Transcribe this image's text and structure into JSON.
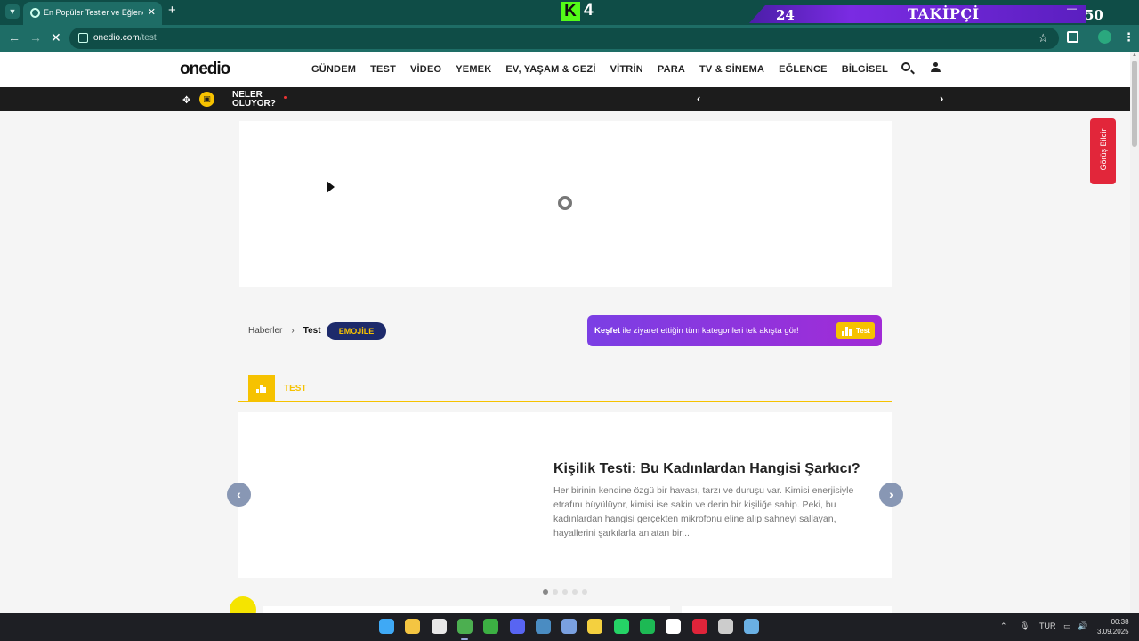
{
  "browser": {
    "tab_title": "En Popüler Testler ve Eğlenceli Testler",
    "url_domain": "onedio.com",
    "url_path": "/test",
    "overlay": {
      "stream_letter": "K",
      "stream_number": "4",
      "follower_count": "24",
      "follower_label": "TAKİPÇİ",
      "follower_target": "50"
    }
  },
  "site": {
    "logo": "onedio",
    "nav": [
      "GÜNDEM",
      "TEST",
      "VİDEO",
      "YEMEK",
      "EV, YAŞAM & GEZİ",
      "VİTRİN",
      "PARA",
      "TV & SİNEMA",
      "EĞLENCE",
      "BİLGİSEL"
    ],
    "subbar": {
      "neler_line1": "NELER",
      "neler_line2": "OLUYOR?"
    }
  },
  "breadcrumb": {
    "home": "Haberler",
    "current": "Test",
    "badge": "EMOJİLE"
  },
  "kesfet": {
    "bold": "Keşfet",
    "text": " ile ziyaret ettiğin tüm kategorileri tek akışta gör!",
    "button": "Test"
  },
  "section": {
    "title": "TEST"
  },
  "slider": {
    "title": "Kişilik Testi: Bu Kadınlardan Hangisi Şarkıcı?",
    "description": "Her birinin kendine özgü bir havası, tarzı ve duruşu var. Kimisi enerjisiyle etrafını büyülüyor, kimisi ise sakin ve derin bir kişiliğe sahip. Peki, bu kadınlardan hangisi gerçekten mikrofonu eline alıp sahneyi sallayan, hayallerini şarkılarla anlatan bir...",
    "prev": "‹",
    "next": "›",
    "dot_count": 5,
    "active_dot": 0
  },
  "feedback": {
    "label": "Görüş Bildir"
  },
  "taskbar": {
    "lang": "TUR",
    "time": "00:38",
    "date": "3.09.2025",
    "apps": [
      {
        "name": "windows-start",
        "color": "#3fa9f5"
      },
      {
        "name": "file-explorer",
        "color": "#f4c542"
      },
      {
        "name": "store",
        "color": "#e8e8e8"
      },
      {
        "name": "chrome",
        "color": "#4caf50"
      },
      {
        "name": "xbox",
        "color": "#3cb043"
      },
      {
        "name": "discord",
        "color": "#5865f2"
      },
      {
        "name": "steam",
        "color": "#4a8cc2"
      },
      {
        "name": "app-blue",
        "color": "#7aa0e0"
      },
      {
        "name": "shield-app",
        "color": "#f4d03f"
      },
      {
        "name": "whatsapp",
        "color": "#25d366"
      },
      {
        "name": "spotify",
        "color": "#1db954"
      },
      {
        "name": "steam-deck",
        "color": "#ffffff"
      },
      {
        "name": "opera",
        "color": "#e0243a"
      },
      {
        "name": "tweaks",
        "color": "#cccccc"
      },
      {
        "name": "steam-2",
        "color": "#6ab0e4"
      }
    ]
  },
  "colors": {
    "accent": "#f6c200",
    "chrome": "#1e6d66",
    "feedback": "#e2263a",
    "kesfet": "#7b3fe4"
  }
}
